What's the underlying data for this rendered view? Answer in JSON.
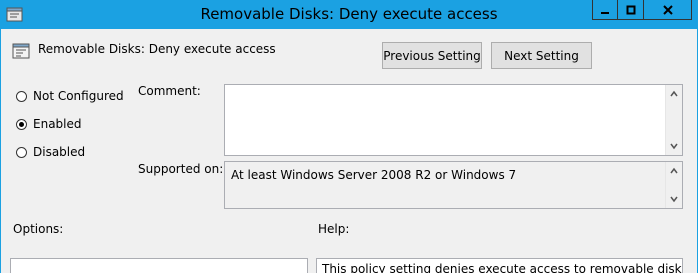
{
  "window": {
    "title": "Removable Disks: Deny execute access"
  },
  "header": {
    "setting_name": "Removable Disks: Deny execute access",
    "prev_label": "Previous Setting",
    "next_label": "Next Setting"
  },
  "state": {
    "options": [
      {
        "label": "Not Configured",
        "selected": false
      },
      {
        "label": "Enabled",
        "selected": true
      },
      {
        "label": "Disabled",
        "selected": false
      }
    ]
  },
  "comment": {
    "label": "Comment:",
    "value": ""
  },
  "supported": {
    "label": "Supported on:",
    "value": "At least Windows Server 2008 R2 or Windows 7"
  },
  "sections": {
    "options_label": "Options:",
    "help_label": "Help:"
  },
  "help": {
    "text": "This policy setting denies execute access to removable disks."
  },
  "colors": {
    "title_bar": "#1ba1e2",
    "client_bg": "#f0f0f0"
  }
}
